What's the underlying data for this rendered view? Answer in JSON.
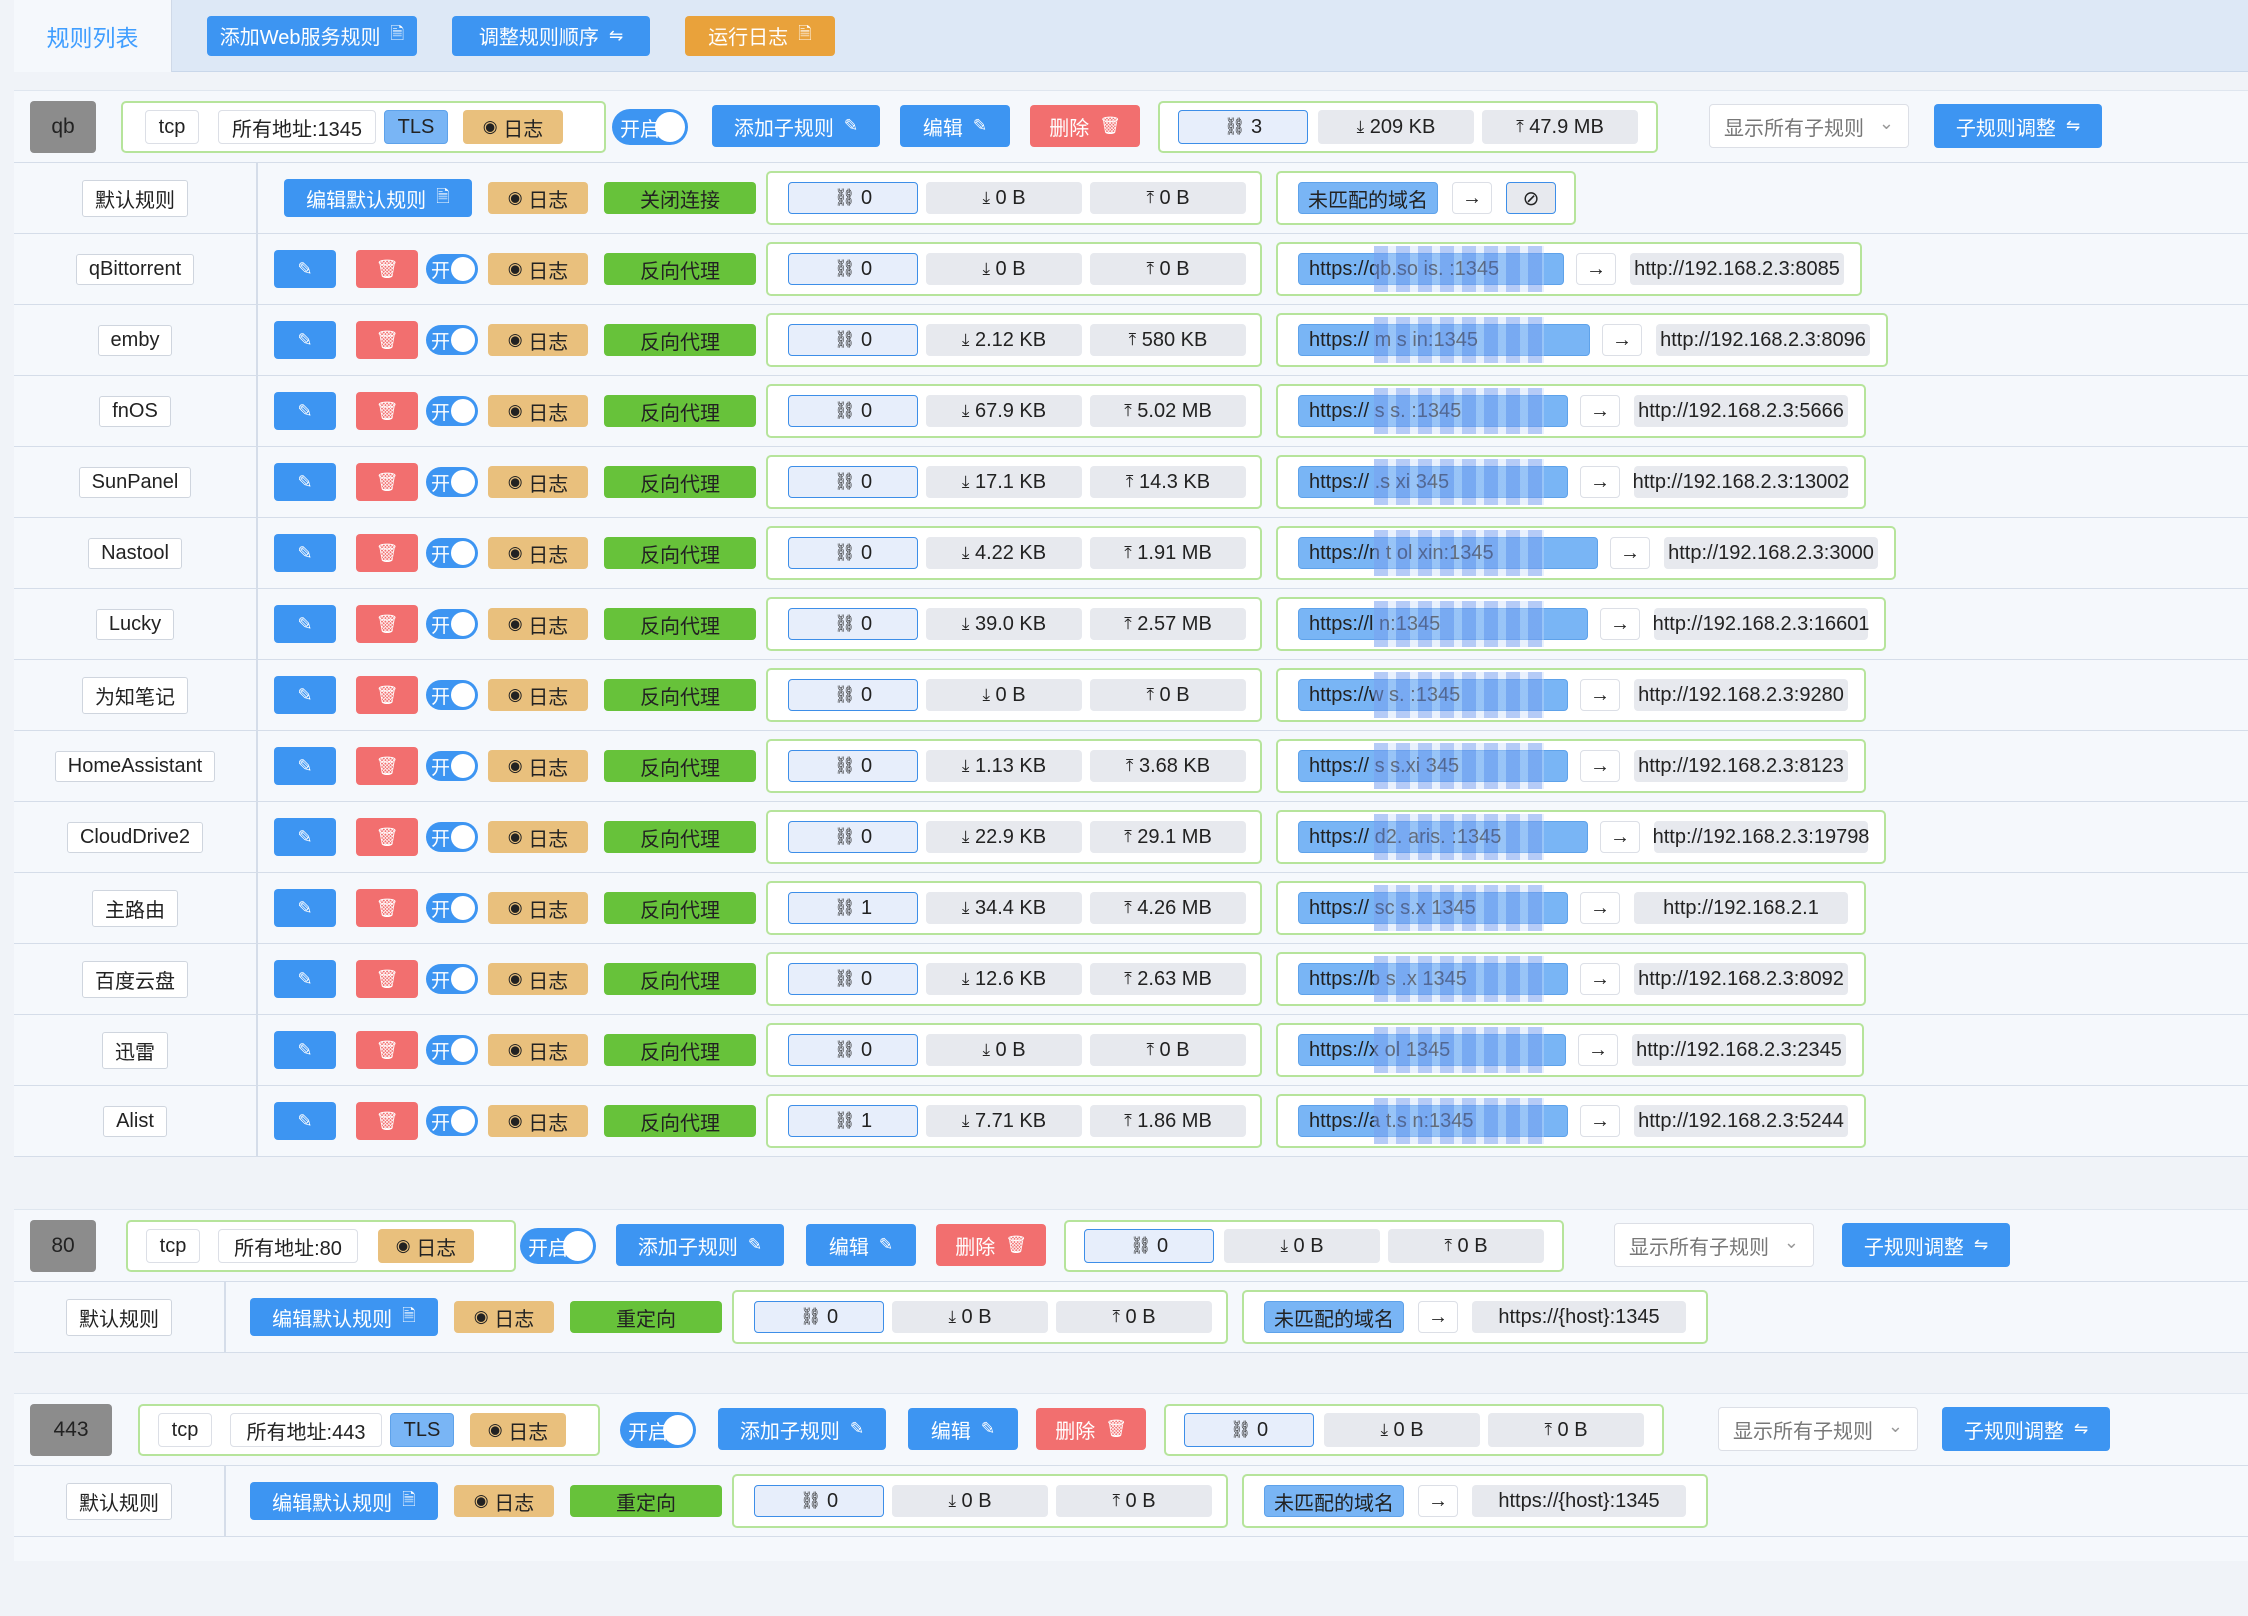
{
  "topbar": {
    "tab_rules": "规则列表",
    "add_web_rule": "添加Web服务规则",
    "adjust_order": "调整规则顺序",
    "run_log": "运行日志"
  },
  "icons": {
    "doc": "document-icon",
    "edit": "edit-icon",
    "delete": "trash-icon",
    "eye": "eye-icon",
    "link": "link-icon",
    "download": "download-icon",
    "upload": "upload-icon",
    "arrow": "arrow-right-icon",
    "swap": "swap-icon",
    "chevron": "chevron-down-icon",
    "unlink": "unlink-icon"
  },
  "colors": {
    "primary": "#3d95f2",
    "danger": "#f26f6f",
    "warning": "#e9a23b",
    "success": "#67c23a"
  },
  "labels": {
    "tcp": "tcp",
    "tls": "TLS",
    "log": "日志",
    "on": "开启",
    "on_short": "开",
    "add_sub": "添加子规则",
    "edit": "编辑",
    "delete": "删除",
    "show_all": "显示所有子规则",
    "sub_adjust": "子规则调整",
    "default_rule": "默认规则",
    "edit_default": "编辑默认规则",
    "close_conn": "关闭连接",
    "redirect": "重定向",
    "reverse_proxy": "反向代理",
    "unmatched": "未匹配的域名"
  },
  "groups": [
    {
      "tag": "qb",
      "addr": "所有地址:1345",
      "conn": "3",
      "down": "209 KB",
      "up": "47.9 MB",
      "default": {
        "action": "关闭连接",
        "conn": "0",
        "down": "0 B",
        "up": "0 B"
      },
      "rules": [
        {
          "name": "qBittorrent",
          "conn": "0",
          "down": "0 B",
          "up": "0 B",
          "from": "https://qb.so   is.   :1345",
          "to": "http://192.168.2.3:8085"
        },
        {
          "name": "emby",
          "conn": "0",
          "down": "2.12 KB",
          "up": "580 KB",
          "from": "https://  m   s        in:1345",
          "to": "http://192.168.2.3:8096"
        },
        {
          "name": "fnOS",
          "conn": "0",
          "down": "67.9 KB",
          "up": "5.02 MB",
          "from": "https://   s     s.   :1345",
          "to": "http://192.168.2.3:5666"
        },
        {
          "name": "SunPanel",
          "conn": "0",
          "down": "17.1 KB",
          "up": "14.3 KB",
          "from": "https://   .s       xi  345",
          "to": "http://192.168.2.3:13002"
        },
        {
          "name": "Nastool",
          "conn": "0",
          "down": "4.22 KB",
          "up": "1.91 MB",
          "from": "https://n    t      ol     xin:1345",
          "to": "http://192.168.2.3:3000"
        },
        {
          "name": "Lucky",
          "conn": "0",
          "down": "39.0 KB",
          "up": "2.57 MB",
          "from": "https://l               n:1345",
          "to": "http://192.168.2.3:16601"
        },
        {
          "name": "为知笔记",
          "conn": "0",
          "down": "0 B",
          "up": "0 B",
          "from": "https://w         s.  :1345",
          "to": "http://192.168.2.3:9280"
        },
        {
          "name": "HomeAssistant",
          "conn": "0",
          "down": "1.13 KB",
          "up": "3.68 KB",
          "from": "https://    s     s.xi  345",
          "to": "http://192.168.2.3:8123"
        },
        {
          "name": "CloudDrive2",
          "conn": "0",
          "down": "22.9 KB",
          "up": "29.1 MB",
          "from": "https://  d2.   aris.   :1345",
          "to": "http://192.168.2.3:19798"
        },
        {
          "name": "主路由",
          "conn": "1",
          "down": "34.4 KB",
          "up": "4.26 MB",
          "from": "https://   sc     s.x  1345",
          "to": "http://192.168.2.1"
        },
        {
          "name": "百度云盘",
          "conn": "0",
          "down": "12.6 KB",
          "up": "2.63 MB",
          "from": "https://b   s     .x   1345",
          "to": "http://192.168.2.3:8092"
        },
        {
          "name": "迅雷",
          "conn": "0",
          "down": "0 B",
          "up": "0 B",
          "from": "https://x   ol        1345",
          "to": "http://192.168.2.3:2345"
        },
        {
          "name": "Alist",
          "conn": "1",
          "down": "7.71 KB",
          "up": "1.86 MB",
          "from": "https://a    t.s        n:1345",
          "to": "http://192.168.2.3:5244"
        }
      ]
    },
    {
      "tag": "80",
      "addr": "所有地址:80",
      "conn": "0",
      "down": "0 B",
      "up": "0 B",
      "default": {
        "action": "重定向",
        "conn": "0",
        "down": "0 B",
        "up": "0 B",
        "to": "https://{host}:1345"
      }
    },
    {
      "tag": "443",
      "addr": "所有地址:443",
      "conn": "0",
      "down": "0 B",
      "up": "0 B",
      "default": {
        "action": "重定向",
        "conn": "0",
        "down": "0 B",
        "up": "0 B",
        "to": "https://{host}:1345"
      }
    }
  ]
}
